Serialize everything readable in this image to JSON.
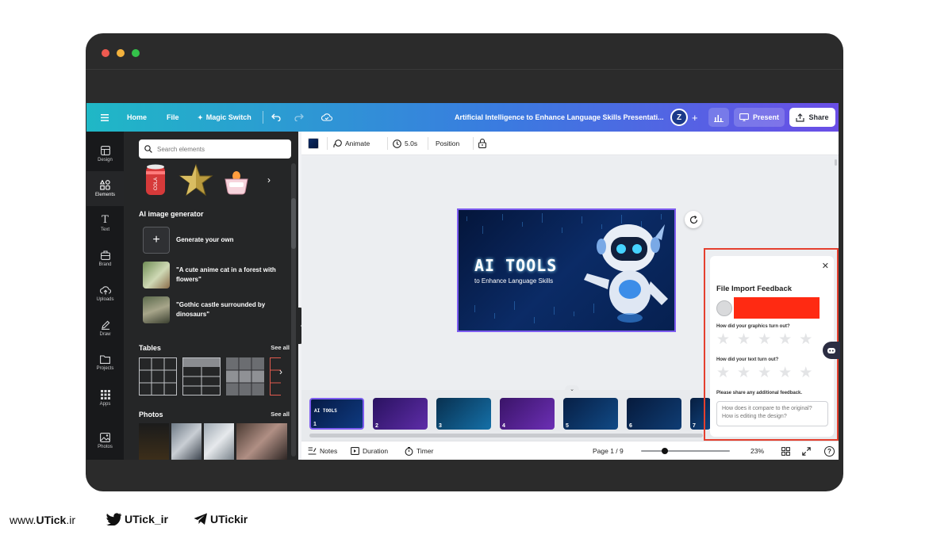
{
  "window": {
    "dot_colors": [
      "#ee5a50",
      "#f3b23d",
      "#34c24a"
    ]
  },
  "header": {
    "menu_icon": "hamburger-icon",
    "home": "Home",
    "file": "File",
    "magic_switch": "Magic Switch",
    "title": "Artificial Intelligence to Enhance Language Skills Presentati...",
    "avatar": "Z",
    "present": "Present",
    "share": "Share"
  },
  "rail": {
    "items": [
      {
        "label": "Design",
        "icon": "layout-icon"
      },
      {
        "label": "Elements",
        "icon": "shapes-icon"
      },
      {
        "label": "Text",
        "icon": "text-icon"
      },
      {
        "label": "Brand",
        "icon": "brand-icon"
      },
      {
        "label": "Uploads",
        "icon": "cloud-upload-icon"
      },
      {
        "label": "Draw",
        "icon": "pen-icon"
      },
      {
        "label": "Projects",
        "icon": "folder-icon"
      },
      {
        "label": "Apps",
        "icon": "apps-grid-icon"
      },
      {
        "label": "Photos",
        "icon": "image-icon"
      }
    ]
  },
  "panel": {
    "search_placeholder": "Search elements",
    "ai_title": "AI image generator",
    "ai_items": [
      "Generate your own",
      "\"A cute anime cat in a forest with flowers\"",
      "\"Gothic castle surrounded by dinosaurs\""
    ],
    "tables_title": "Tables",
    "photos_title": "Photos",
    "see_all": "See all"
  },
  "toolbar": {
    "animate": "Animate",
    "duration": "5.0s",
    "position": "Position"
  },
  "slide": {
    "title": "AI TOOLS",
    "subtitle": "to Enhance Language Skills"
  },
  "thumbnails": [
    "1",
    "2",
    "3",
    "4",
    "5",
    "6",
    "7"
  ],
  "footer": {
    "notes": "Notes",
    "duration": "Duration",
    "timer": "Timer",
    "page": "Page 1 / 9",
    "zoom": "23%",
    "zoom_level": 0.23
  },
  "feedback": {
    "title": "File Import Feedback",
    "q1": "How did your graphics turn out?",
    "q2": "How did your text turn out?",
    "q3": "Please share any additional feedback.",
    "textarea_placeholder": "How does it compare to the original? How is editing the design?",
    "highlight_color": "#ff2a12"
  },
  "brand_footer": {
    "site_prefix": "www.",
    "site_bold": "UTick",
    "site_suffix": ".ir",
    "twitter": "UTick_ir",
    "telegram": "UTickir"
  }
}
